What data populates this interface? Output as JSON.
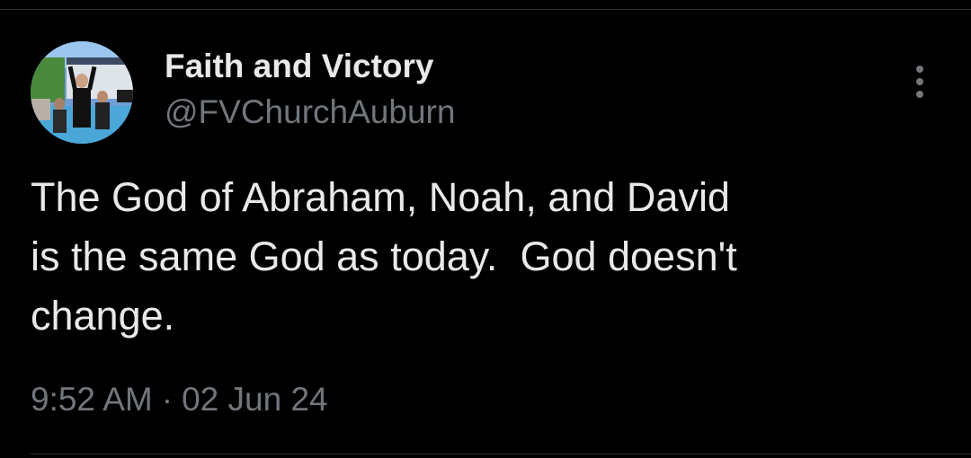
{
  "tweet": {
    "author": {
      "display_name": "Faith and Victory",
      "handle": "@FVChurchAuburn",
      "avatar": "baptism-photo"
    },
    "text_lines": [
      "The God of Abraham, Noah, and David",
      "is the same God as today.  God doesn't",
      "change."
    ],
    "time": "9:52 AM",
    "separator": "·",
    "date": "02 Jun 24",
    "more_icon": "more-vertical-icon"
  },
  "colors": {
    "background": "#000000",
    "primary_text": "#e7e9ea",
    "secondary_text": "#71767b",
    "divider": "#2f3336"
  }
}
